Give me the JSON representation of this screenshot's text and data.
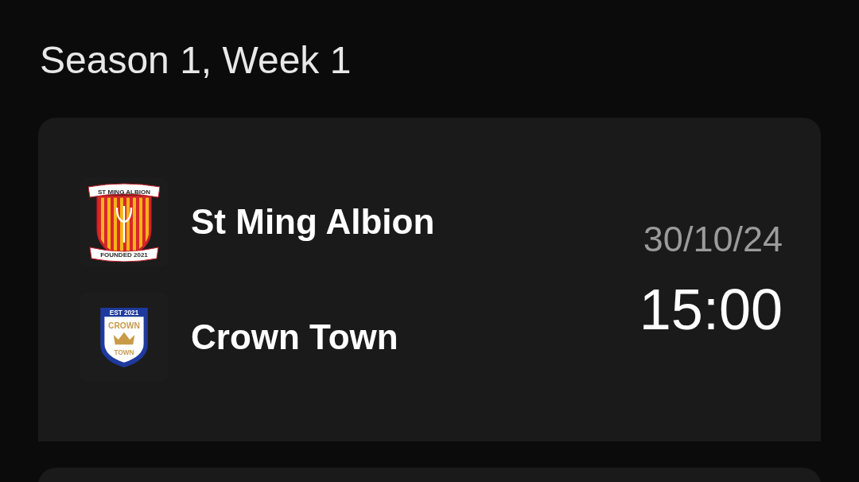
{
  "heading": "Season 1, Week 1",
  "match": {
    "teams": [
      {
        "name": "St Ming Albion",
        "crest": {
          "kind": "striped",
          "top_text": "ST MING ALBION",
          "bottom_text": "FOUNDED 2021"
        }
      },
      {
        "name": "Crown Town",
        "crest": {
          "kind": "crowned",
          "top_text": "EST 2021",
          "middle_text": "CROWN",
          "bottom_text": "TOWN"
        }
      }
    ],
    "date": "30/10/24",
    "time": "15:00"
  }
}
